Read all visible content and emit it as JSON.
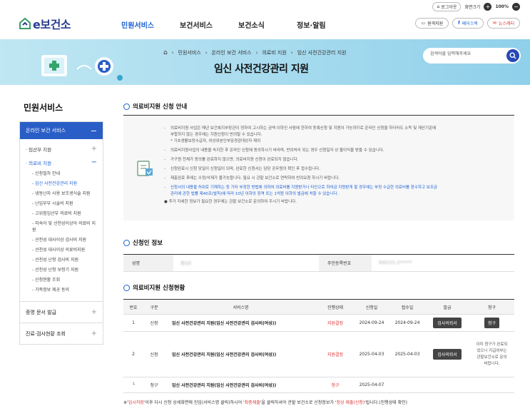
{
  "util": {
    "logout": "로그아웃",
    "zoom_label": "화면크기",
    "zoom_value": "100%",
    "zoom_in": "+",
    "zoom_out": "−"
  },
  "header": {
    "logo": "e보건소",
    "gnb": [
      "민원서비스",
      "보건서비스",
      "보건소식",
      "정보·알림"
    ],
    "buttons": {
      "remote": "원격지원",
      "facebook": "페이스북",
      "newsletter": "뉴스레터"
    }
  },
  "banner": {
    "breadcrumbs": [
      "민원서비스",
      "온라인 보건 서비스",
      "의료비 지원",
      "임신 사전건강관리 지원"
    ],
    "title": "임신 사전건강관리 지원",
    "search_placeholder": "검색어를 입력해주세요"
  },
  "sidebar": {
    "title": "민원서비스",
    "head": "온라인 보건 서비스",
    "level2": [
      {
        "label": "· 임산부 지원",
        "open": false
      },
      {
        "label": "· 의료비 지원",
        "open": true
      }
    ],
    "level3": [
      "- 신청절차 안내",
      "- 임신 사전건강관리 지원",
      "- 냉동난자 사용 보조생식술 지원",
      "- 난임부부 시술비 지원",
      "- 고위험임산부 의료비 지원",
      "- 미숙아 및 선천성이상아 의료비 지원",
      "- 선천성 대사이상 검사비 지원",
      "- 선천성 대사이상 의료비지원",
      "- 선천성 난청 검사비 지원",
      "- 선천성 난청 보청기 지원",
      "- 신청현황 조회",
      "- 가족정보 제공 동의"
    ],
    "active_level3": 1,
    "level1": [
      "증명 문서 발급",
      "진료·검사현황 조회"
    ]
  },
  "notice": {
    "title": "의료비지원 신청 안내",
    "items": [
      "의료비지원 사업은 매년 보건복지부장관이 정하여 고시하는 금액 이하인 사람에 한하여 등록신청 및 지원이 가능하므로 온라인 신청을 하더라도 소득 및 재산기준에",
      "부합하지 않는 경우에는 지원신청이 반려될 수 있습니다.",
      "* 기초생활보장수급자, 차상위본인부담경감대상자 제외",
      "의료비지원사업의 내용을 숙지한 후 온라인 신청에 동의하시기 바라며, 반려처리 되는 경우 신청일자 상 불이익을 받을 수 있습니다.",
      "가구원 전체가 동의를 완료하지 않으면, 의료비지원 신청이 완료되지 않습니다.",
      "신청완료시 신청 당일이 신청일이 되며, 완료한 신청서는 담당 공무원의 확인 후 접수됩니다.",
      "제출완료 후에는 수정/삭제가 불가능합니다. 필요 시 관할 보건소로 연락하여 반려요청 하시기 바랍니다.",
      "신청서의 내용을 허위로 기재하는 등 기타 부정한 방법에 의하여 의료비를 지원받거나 타인으로 하여금 지원받게 할 경우에는 부정 수급한 의료비를 환수하고 보조금",
      "관리에 관한 법률 제40조(벌칙)에 따라 10년 이하의 징역 또는 1억원 이하의 벌금에 처할 수 있습니다.",
      "추가 자세한 정보가 필요한 경우에는 관할 보건소로 문의하여 주시기 바랍니다."
    ]
  },
  "applicant": {
    "title": "신청인 정보",
    "name_label": "성명",
    "name_value": "홍O순",
    "rrn_label": "주민등록번호",
    "rrn_value": "900101-2******"
  },
  "status": {
    "title": "의료비지원 신청현황",
    "headers": [
      "번호",
      "구분",
      "서비스명",
      "진행상태",
      "신청일",
      "접수일",
      "발급",
      "청구"
    ],
    "rows": [
      {
        "no": "1",
        "type": "신청",
        "service": "임신 사전건강관리 지원(임신 사전건강관리 검사비(여성))",
        "state": "지원결정",
        "applied": "2024-09-24",
        "received": "2024-09-24",
        "issue": "검사의뢰서",
        "claim": "청구"
      },
      {
        "no": "2",
        "type": "신청",
        "service": "임신 사전건강관리 지원(임신 사전건강관리 검사비(여성))",
        "state": "지원결정",
        "applied": "2025-04-03",
        "received": "2025-04-03",
        "issue": "검사의뢰서",
        "claim": "이미 청구가 완료되었으니 지급여부는 관할보건소로 문의바랍니다."
      },
      {
        "no": "└",
        "type": "청구",
        "service": "임신 사전건강관리 지원(임신 사전건강관리 검사비(여성))",
        "state": "청구",
        "applied": "2025-04-07",
        "received": "",
        "issue": "",
        "claim": ""
      }
    ]
  },
  "footer": {
    "part1": "※'",
    "temp": "임시저장",
    "part2": "'이후 다시 신청 상세화면에 진입(서비스명 클릭)하시어 '",
    "final": "최종제출",
    "part3": "'을 클릭하셔야 관할 보건소로 신청정보가 '",
    "normal": "정상 제출(신청)",
    "part4": "'됩니다.(진행상태 확인)"
  }
}
